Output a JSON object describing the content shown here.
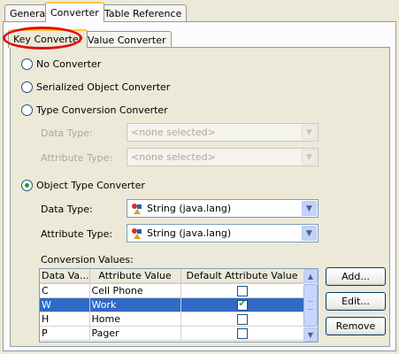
{
  "tabs": [
    "General",
    "Converter",
    "Table Reference"
  ],
  "inner_tabs": [
    "Key Converter",
    "Value Converter"
  ],
  "options": {
    "no_converter": "No Converter",
    "serialized": "Serialized Object Converter",
    "type_conversion": "Type Conversion Converter",
    "object_type": "Object Type Converter"
  },
  "type_conversion_fields": {
    "data_type_label": "Data Type:",
    "data_type_value": "<none selected>",
    "attribute_type_label": "Attribute Type:",
    "attribute_type_value": "<none selected>"
  },
  "object_type_fields": {
    "data_type_label": "Data Type:",
    "data_type_value": "String (java.lang)",
    "attribute_type_label": "Attribute Type:",
    "attribute_type_value": "String (java.lang)"
  },
  "conversion": {
    "label": "Conversion Values:",
    "columns": [
      "Data Va...",
      "Attribute Value",
      "Default Attribute Value"
    ],
    "rows": [
      {
        "data": "C",
        "attr": "Cell Phone",
        "default": false
      },
      {
        "data": "W",
        "attr": "Work",
        "default": true
      },
      {
        "data": "H",
        "attr": "Home",
        "default": false
      },
      {
        "data": "P",
        "attr": "Pager",
        "default": false
      }
    ],
    "selected_row": 1
  },
  "buttons": {
    "add": "Add...",
    "edit": "Edit...",
    "remove": "Remove"
  },
  "colors": {
    "selection": "#316ac5",
    "highlight_ring": "#e01010",
    "tab_accent": "#ffc83c"
  },
  "icons": {
    "java_class": "java-class-icon",
    "dropdown": "chevron-down-icon"
  }
}
